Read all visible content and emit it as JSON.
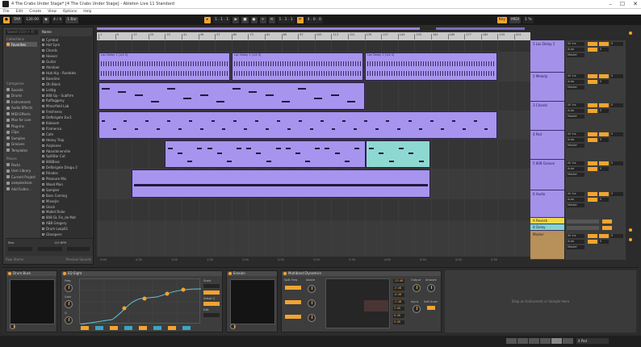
{
  "window": {
    "title": "4 The Crabs Under Stage* [4 The Crabs Under Stage] - Ableton Live 11 Standard",
    "controls": [
      "–",
      "☐",
      "✕"
    ]
  },
  "menu": [
    "File",
    "Edit",
    "Create",
    "View",
    "Options",
    "Help"
  ],
  "transport": {
    "tempo": "120.00",
    "signature": "4 / 4",
    "position": "1 . 1 . 1",
    "key_label": "Key",
    "midi_label": "MIDI",
    "cpu": "1 %"
  },
  "browser": {
    "search_placeholder": "Search (Ctrl + F)",
    "name_header": "Name",
    "categories_header": "Categories",
    "categories": [
      "Sounds",
      "Drums",
      "Instruments",
      "Audio Effects",
      "MIDI Effects",
      "Max for Live",
      "Plug-Ins",
      "Clips",
      "Samples",
      "Grooves",
      "Templates"
    ],
    "places_header": "Places",
    "places": [
      "Packs",
      "User Library",
      "Current Project",
      "sampleshare",
      "Add Folder..."
    ],
    "files": [
      "Cymbal",
      "Hat Sym",
      "Chords",
      "Hoover",
      "Guitar",
      "Ahmbier",
      "Hub Hip - Rumbles",
      "Baseline",
      "Oh Black",
      "Listbg",
      "808 Gp - Subfirm",
      "Ruffaggeny",
      "Minorfield Lab",
      "Freshness",
      "Defbrigate Exc1",
      "Kaboom",
      "Flamenco",
      "Cafe",
      "Heavy Trap",
      "Airplanes",
      "Abandonerville",
      "SplitBar Cut",
      "808Bass",
      "Defbrigate Disigu 2",
      "Rhodes",
      "Pleasure Mix",
      "Wood Man",
      "Sampler",
      "Bass Coming",
      "Minarjle",
      "Glock",
      "Mallet Rider",
      "808 GL Fin_do Mat",
      "ABB Grogery",
      "Drum Loop01",
      "Glasspers"
    ],
    "preview_label": "Raw",
    "preview_tempo": "120 BPM",
    "footer_left": "Raw Stems",
    "footer_right": "Preview Sounds"
  },
  "arrangement": {
    "ruler": [
      "1",
      "9",
      "17",
      "25",
      "33",
      "41",
      "49",
      "57",
      "65",
      "73",
      "81",
      "89",
      "97",
      "105",
      "113",
      "121",
      "129",
      "137",
      "145",
      "153",
      "161",
      "169",
      "177",
      "185",
      "193",
      "201"
    ],
    "clips": [
      {
        "lane": 0,
        "label": "Lac Delay 1 [1/4 S]",
        "kind": "audio"
      },
      {
        "lane": 0,
        "label": "Lac Delay 1 [1/4 S]",
        "kind": "audio"
      },
      {
        "lane": 0,
        "label": "Lac Delay 1 [1/4 S]",
        "kind": "audio"
      },
      {
        "lane": 1,
        "label": "",
        "kind": "midi"
      },
      {
        "lane": 2,
        "label": "",
        "kind": "midi"
      },
      {
        "lane": 3,
        "label": "",
        "kind": "midi"
      },
      {
        "lane": 3,
        "label": "",
        "kind": "midi-teal"
      },
      {
        "lane": 4,
        "label": "",
        "kind": "midi"
      }
    ],
    "footer_times": [
      "0:00",
      "0:30",
      "1:00",
      "1:30",
      "2:00",
      "2:30",
      "3:00",
      "3:30",
      "4:00",
      "4:30",
      "5:00",
      "5:30"
    ]
  },
  "tracks": [
    {
      "name": "1 Lac Delay 1",
      "color": "#a491ea"
    },
    {
      "name": "2 Melody",
      "color": "#a491ea"
    },
    {
      "name": "3 Chords",
      "color": "#a491ea"
    },
    {
      "name": "4 Pad",
      "color": "#a491ea"
    },
    {
      "name": "5 808 Groove",
      "color": "#a491ea"
    },
    {
      "name": "6 Audio",
      "color": "#a491ea"
    },
    {
      "name": "A Reverb",
      "color": "#f0d84a"
    },
    {
      "name": "B Delay",
      "color": "#7fd6cf"
    },
    {
      "name": "Master",
      "color": "#b7905a"
    }
  ],
  "mixer": {
    "input_label": "All Ins",
    "monitor": "Auto",
    "output": "Master",
    "volume": "0",
    "sends": "S"
  },
  "devices": [
    {
      "name": "Drum Buss",
      "kind": "screen"
    },
    {
      "name": "EQ Eight",
      "kind": "eq"
    },
    {
      "name": "Erosion",
      "kind": "screen"
    },
    {
      "name": "Multiband Dynamics",
      "kind": "dynamics"
    }
  ],
  "device_panel": {
    "drop_text": "Drop an Instrument or Sample Here",
    "eq_labels": [
      "Freq",
      "Gain",
      "Q",
      "Scale",
      "Adapt Q",
      "Edit"
    ],
    "dyn_labels": [
      "Above",
      "Below",
      "Time",
      "Split Freq",
      "Output",
      "Input",
      "Amount",
      "Soft Knee"
    ],
    "dyn_values": [
      "-20 dB",
      "-9 dB",
      "-6 dB",
      "-3 dB",
      "3 dB",
      "6 dB",
      "9 dB"
    ]
  },
  "status": {
    "track_name": "4 Pad"
  }
}
